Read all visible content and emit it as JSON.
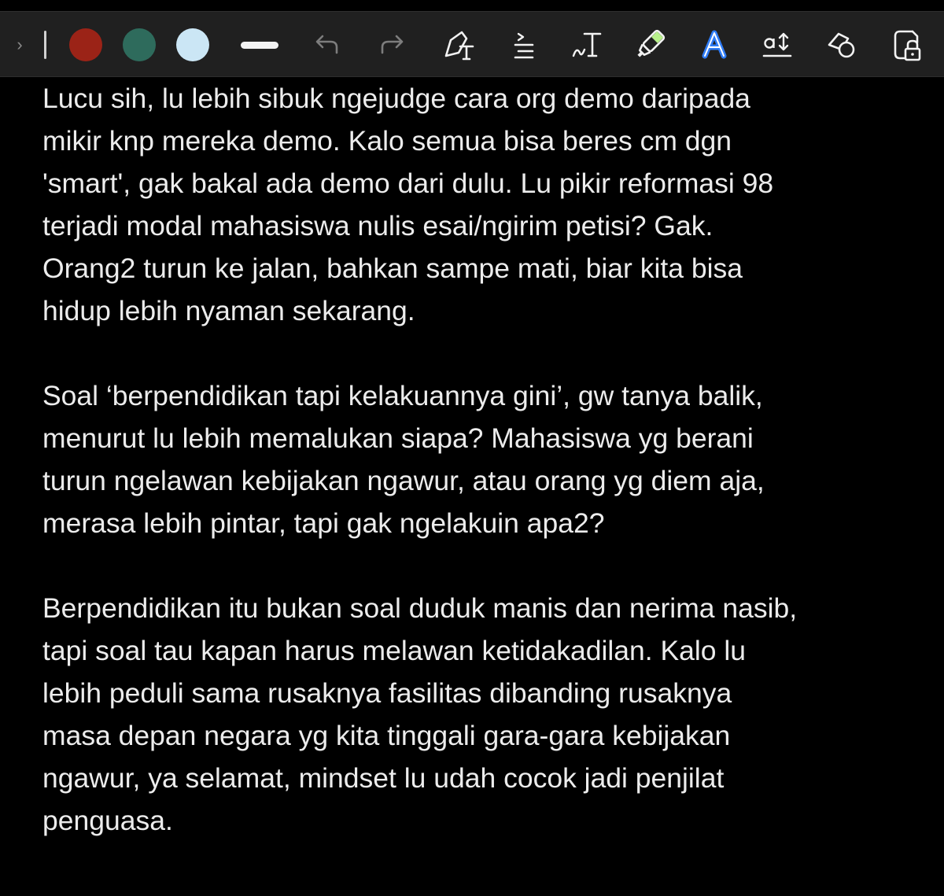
{
  "toolbar": {
    "collapse_glyph": "›",
    "colors": [
      "#9b2317",
      "#2e6b5c",
      "#cbe6f5"
    ],
    "icons": [
      "undo-icon",
      "redo-icon",
      "text-box-icon",
      "align-text-icon",
      "handwriting-to-text-icon",
      "highlighter-icon",
      "text-style-icon",
      "text-size-icon",
      "shape-eraser-icon",
      "lock-icon"
    ]
  },
  "content": {
    "paragraphs": [
      {
        "lines": [
          "Lucu sih, lu lebih sibuk ngejudge cara org demo daripada",
          "mikir knp mereka demo. Kalo semua bisa beres cm dgn",
          "'smart', gak bakal ada demo dari dulu. Lu pikir reformasi 98",
          "terjadi modal mahasiswa nulis esai/ngirim petisi? Gak.",
          "Orang2 turun ke jalan, bahkan sampe mati, biar kita bisa",
          "hidup lebih nyaman sekarang."
        ]
      },
      {
        "lines": [
          "Soal ‘berpendidikan tapi kelakuannya gini’, gw tanya balik,",
          "menurut lu lebih memalukan siapa? Mahasiswa yg berani",
          "turun ngelawan kebijakan ngawur, atau orang yg diem aja,",
          "merasa lebih pintar, tapi gak ngelakuin apa2?"
        ]
      },
      {
        "lines": [
          "Berpendidikan itu bukan soal duduk manis dan nerima nasib,",
          "tapi soal tau kapan harus melawan ketidakadilan. Kalo lu",
          "lebih peduli sama rusaknya fasilitas dibanding rusaknya",
          "masa depan negara yg kita tinggali gara-gara kebijakan",
          "ngawur, ya selamat, mindset lu udah cocok jadi penjilat",
          "penguasa."
        ]
      }
    ]
  }
}
